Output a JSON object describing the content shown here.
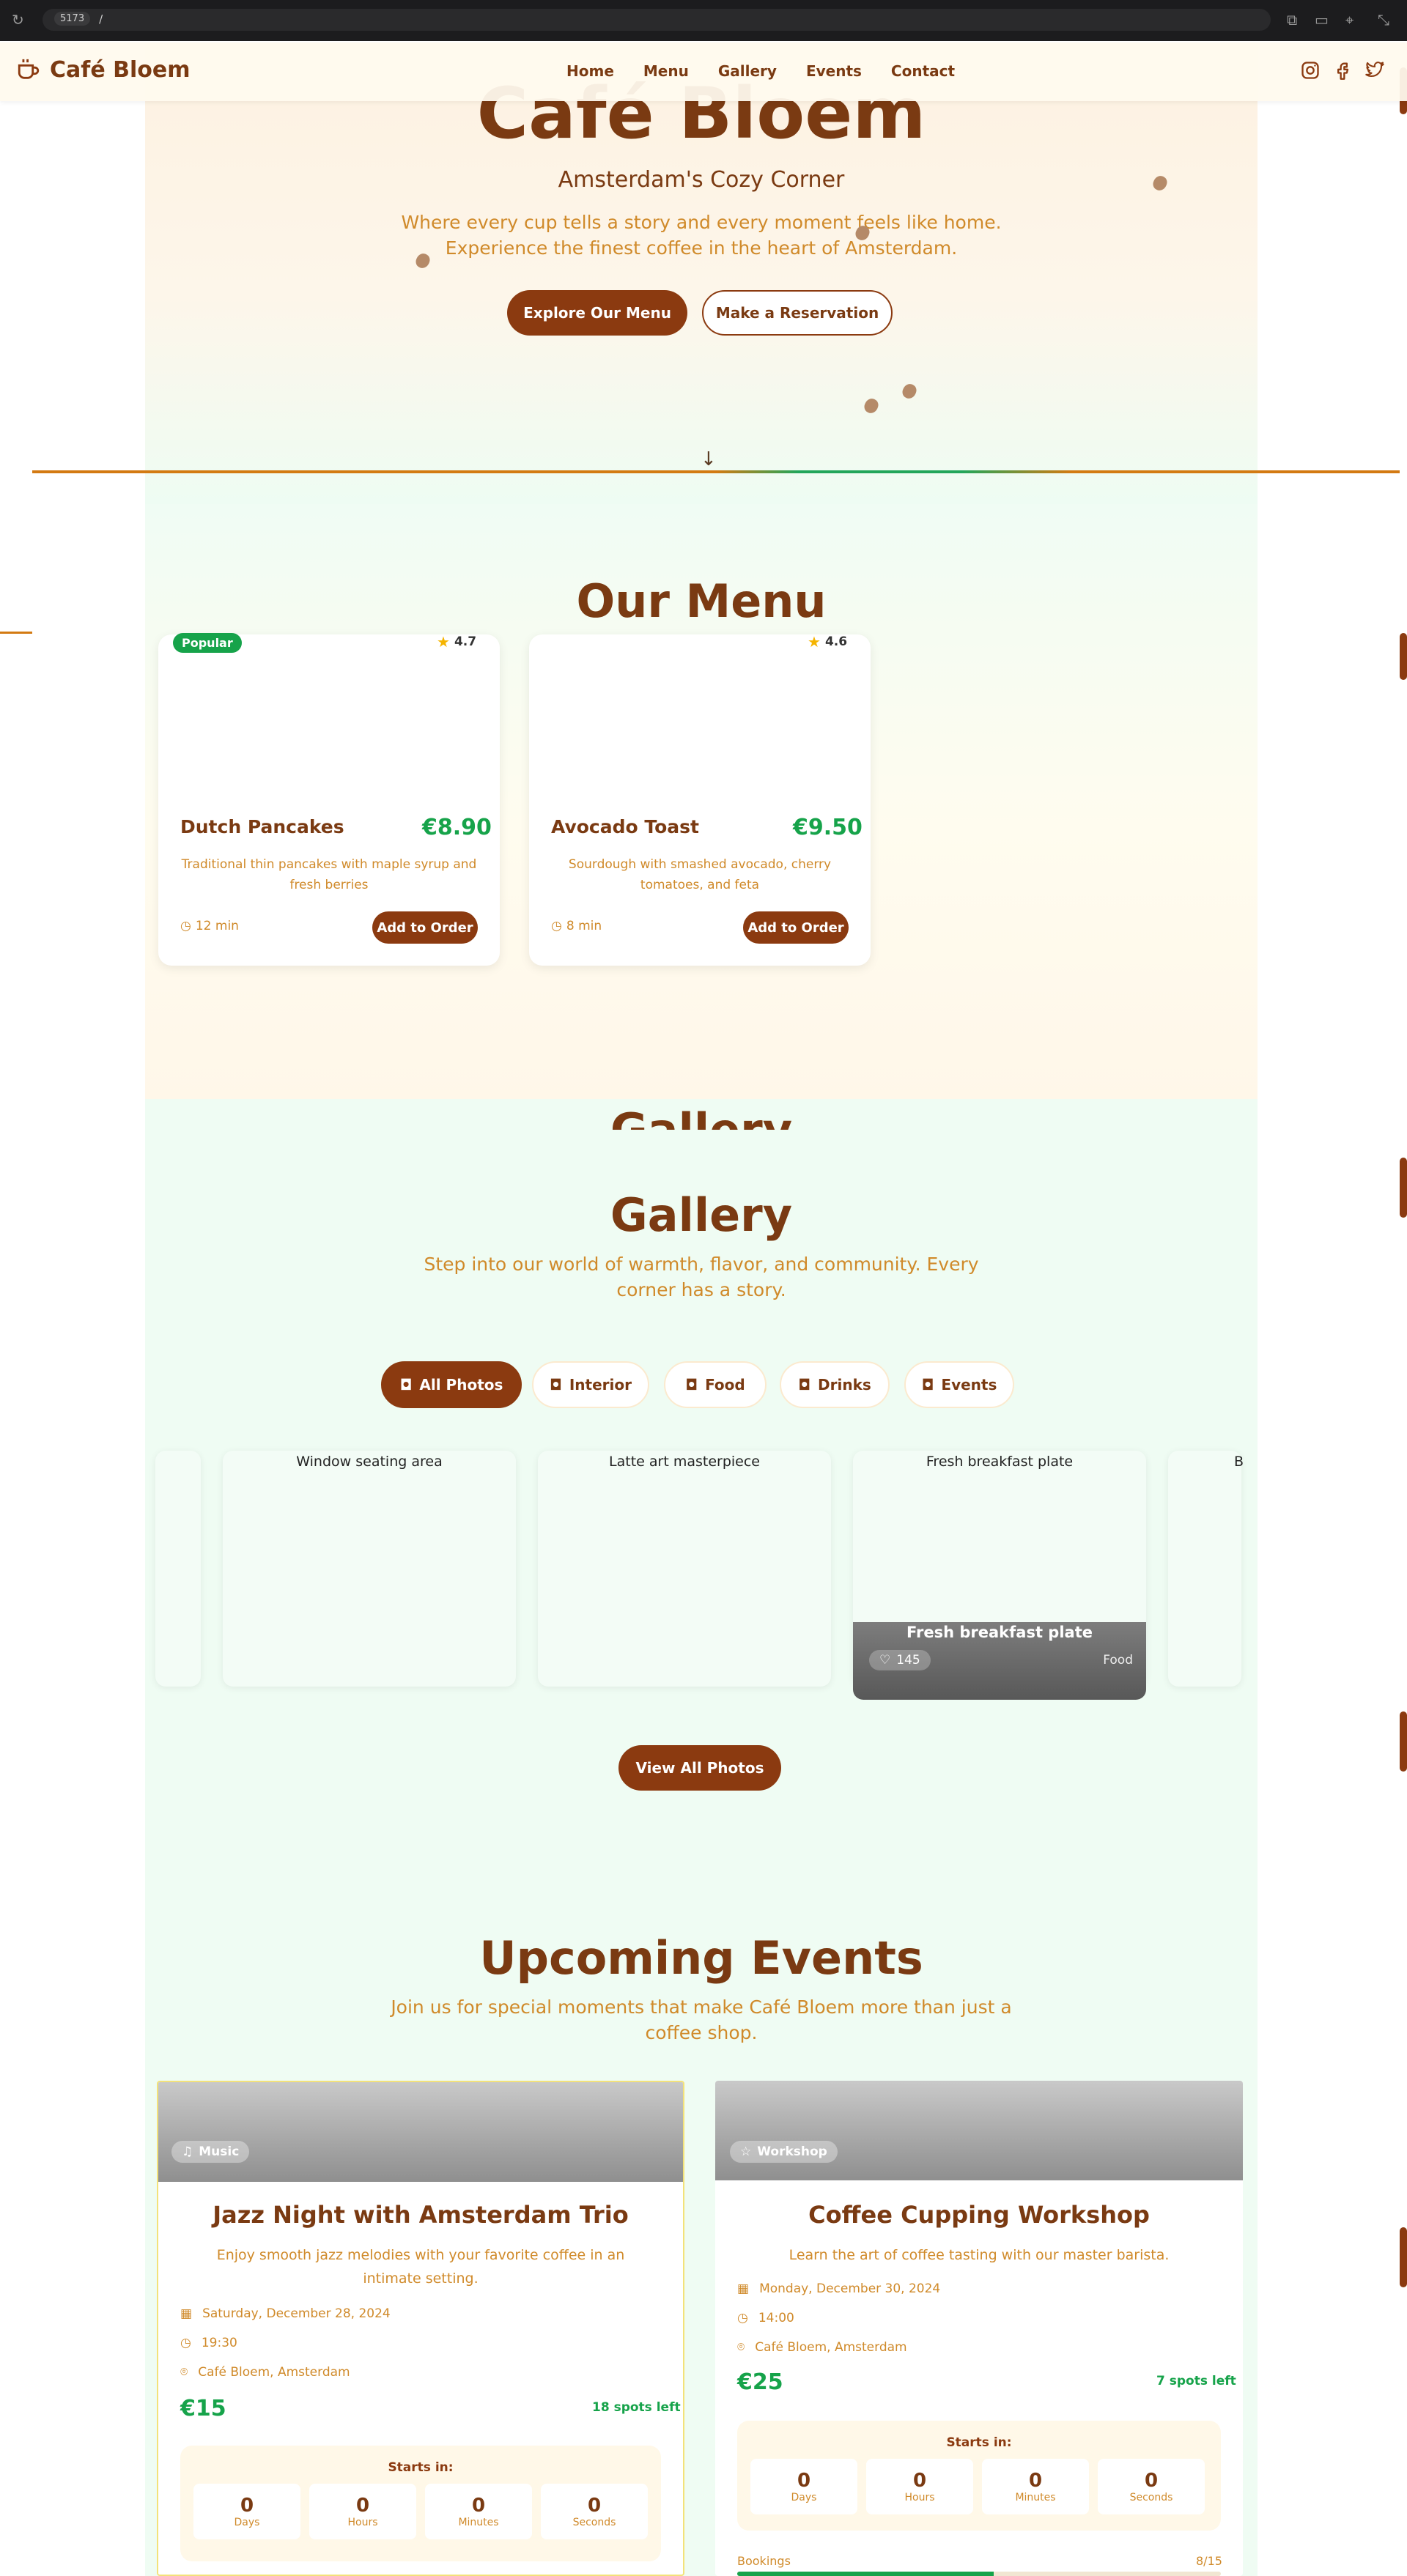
{
  "browser": {
    "port": "5173",
    "path": "/"
  },
  "nav": {
    "brand": "Café Bloem",
    "links": [
      "Home",
      "Menu",
      "Gallery",
      "Events",
      "Contact"
    ]
  },
  "hero": {
    "title": "Café Bloem",
    "subtitle": "Amsterdam's Cozy Corner",
    "description": "Where every cup tells a story and every moment feels like home. Experience the finest coffee in the heart of Amsterdam.",
    "primary_cta": "Explore Our Menu",
    "secondary_cta": "Make a Reservation"
  },
  "menu": {
    "title": "Our Menu",
    "items": [
      {
        "badge": "Popular",
        "rating": "4.7",
        "name": "Dutch Pancakes",
        "price": "€8.90",
        "description": "Traditional thin pancakes with maple syrup and fresh berries",
        "time": "12 min",
        "button": "Add to Order"
      },
      {
        "badge": "",
        "rating": "4.6",
        "name": "Avocado Toast",
        "price": "€9.50",
        "description": "Sourdough with smashed avocado, cherry tomatoes, and feta",
        "time": "8 min",
        "button": "Add to Order"
      }
    ]
  },
  "gallery": {
    "title": "Gallery",
    "subtitle": "Step into our world of warmth, flavor, and community. Every corner has a story.",
    "filters": [
      "All Photos",
      "Interior",
      "Food",
      "Drinks",
      "Events"
    ],
    "photos": [
      {
        "alt": "Window seating area"
      },
      {
        "alt": "Latte art masterpiece"
      },
      {
        "alt": "Fresh breakfast plate",
        "overlay_title": "Fresh breakfast plate",
        "likes": "145",
        "category": "Food"
      },
      {
        "alt": "B"
      }
    ],
    "view_all": "View All Photos"
  },
  "events": {
    "title": "Upcoming Events",
    "subtitle": "Join us for special moments that make Café Bloem more than just a coffee shop.",
    "items": [
      {
        "tag": "Music",
        "title": "Jazz Night with Amsterdam Trio",
        "description": "Enjoy smooth jazz melodies with your favorite coffee in an intimate setting.",
        "date": "Saturday, December 28, 2024",
        "time": "19:30",
        "location": "Café Bloem, Amsterdam",
        "price": "€15",
        "spots": "18 spots left",
        "countdown_label": "Starts in:",
        "countdown": [
          {
            "n": "0",
            "u": "Days"
          },
          {
            "n": "0",
            "u": "Hours"
          },
          {
            "n": "0",
            "u": "Minutes"
          },
          {
            "n": "0",
            "u": "Seconds"
          }
        ]
      },
      {
        "tag": "Workshop",
        "title": "Coffee Cupping Workshop",
        "description": "Learn the art of coffee tasting with our master barista.",
        "date": "Monday, December 30, 2024",
        "time": "14:00",
        "location": "Café Bloem, Amsterdam",
        "price": "€25",
        "spots": "7 spots left",
        "countdown_label": "Starts in:",
        "countdown": [
          {
            "n": "0",
            "u": "Days"
          },
          {
            "n": "0",
            "u": "Hours"
          },
          {
            "n": "0",
            "u": "Minutes"
          },
          {
            "n": "0",
            "u": "Seconds"
          }
        ],
        "bookings_label": "Bookings",
        "bookings": "8/15",
        "bookings_fraction": 0.53
      }
    ]
  },
  "colors": {
    "brand_brown": "#8b3a10",
    "accent_orange": "#d08a2a",
    "accent_green": "#16a34a"
  }
}
